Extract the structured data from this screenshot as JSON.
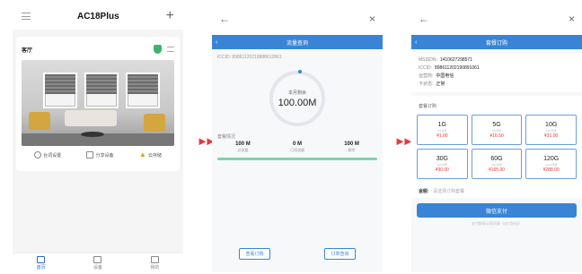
{
  "home": {
    "title": "AC18Plus",
    "card_title": "客厅",
    "actions": [
      "台词设置",
      "分享设备",
      "云存储"
    ],
    "tabs": [
      {
        "label": "首页",
        "active": true
      },
      {
        "label": "设备",
        "active": false
      },
      {
        "label": "我的",
        "active": false
      }
    ]
  },
  "flow": {
    "title": "流量查询",
    "iccid": "ICCID: 89861120218888612861",
    "ring_label": "本月剩余",
    "ring_value": "100.00M",
    "usage_title": "套餐情况",
    "stats": [
      {
        "value": "100 M",
        "label": "总流量"
      },
      {
        "value": "0 M",
        "label": "已用流量"
      },
      {
        "value": "100 M",
        "label": "剩余"
      }
    ],
    "remaining_fraction": 1.0,
    "buttons": [
      "查看订购",
      "订单查询"
    ]
  },
  "order": {
    "title": "套餐订购",
    "info": [
      {
        "label": "MSISDN:",
        "value": "1410627298571"
      },
      {
        "label": "ICCID:",
        "value": "898611202190891061"
      },
      {
        "label": "运营商:",
        "value": "中国电信"
      },
      {
        "label": "卡状态:",
        "value": "正常"
      }
    ],
    "section_label": "套餐订购",
    "packages": [
      {
        "size": "1G",
        "sub": "1G流量",
        "price": "¥1.00"
      },
      {
        "size": "5G",
        "sub": "5G流量",
        "price": "¥16.50"
      },
      {
        "size": "10G",
        "sub": "10G流量",
        "price": "¥31.00"
      },
      {
        "size": "30G",
        "sub": "30G流量",
        "price": "¥90.00"
      },
      {
        "size": "60G",
        "sub": "60G流量",
        "price": "¥165.00"
      },
      {
        "size": "120G",
        "sub": "120G流量",
        "price": "¥288.00"
      }
    ],
    "amount_label": "金额:",
    "amount_placeholder": "请选择订购套餐",
    "pay_label": "微信支付",
    "note": "支付即表示您同意《支付协议》"
  },
  "colors": {
    "accent": "#3a84d6",
    "price": "#e8383d",
    "arrow": "#e8383d"
  }
}
